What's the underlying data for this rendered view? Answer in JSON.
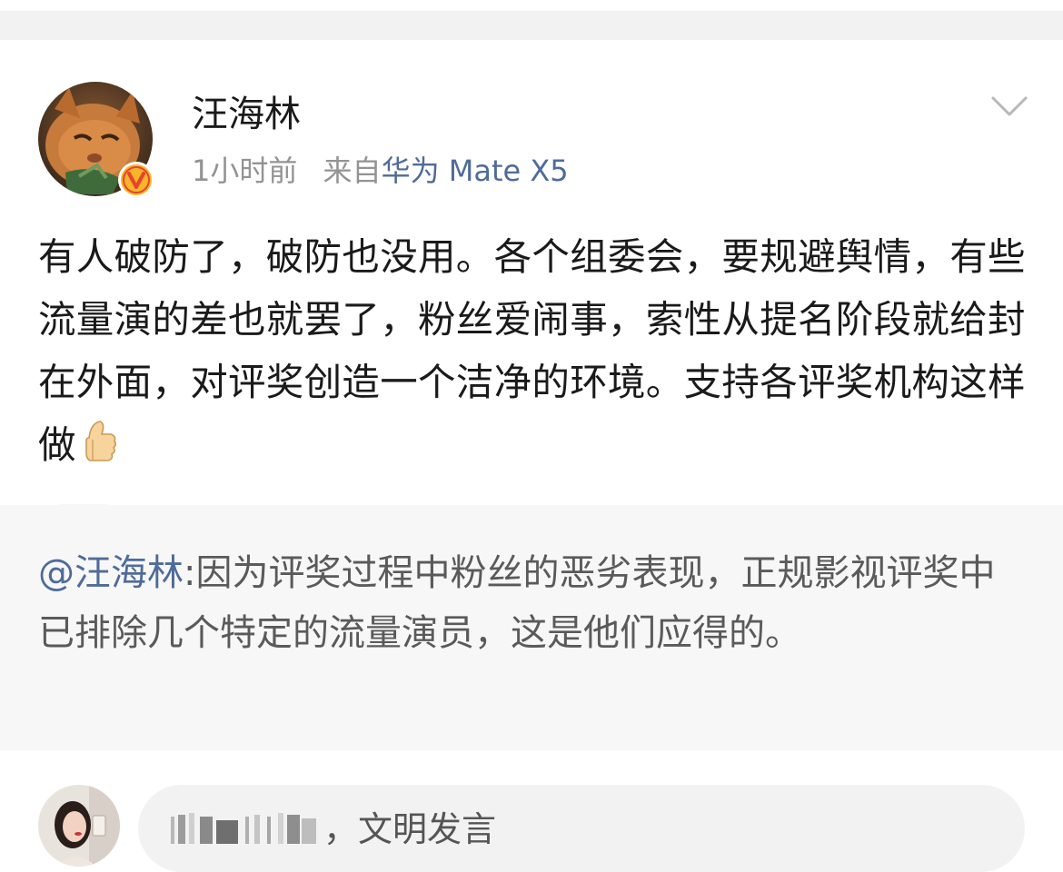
{
  "post": {
    "author": "汪海林",
    "time": "1小时前",
    "source_prefix": "来自",
    "source_device": "华为 Mate X5",
    "text": "有人破防了，破防也没用。各个组委会，要规避舆情，有些流量演的差也就罢了，粉丝爱闹事，索性从提名阶段就给封在外面，对评奖创造一个洁净的环境。支持各评奖机构这样做"
  },
  "repost": {
    "mention": "@汪海林",
    "text": ":因为评奖过程中粉丝的恶劣表现，正规影视评奖中已排除几个特定的流量演员，这是他们应得的。"
  },
  "comment_bar": {
    "placeholder": "，文明发言"
  },
  "icons": {
    "more": "chevron-down-icon",
    "verified": "verified-v-badge-icon",
    "emoji": "thumbs-up-emoji-icon"
  },
  "colors": {
    "link": "#4f6b99",
    "badge": "#f5a623",
    "badge_ring": "#e8432c"
  }
}
